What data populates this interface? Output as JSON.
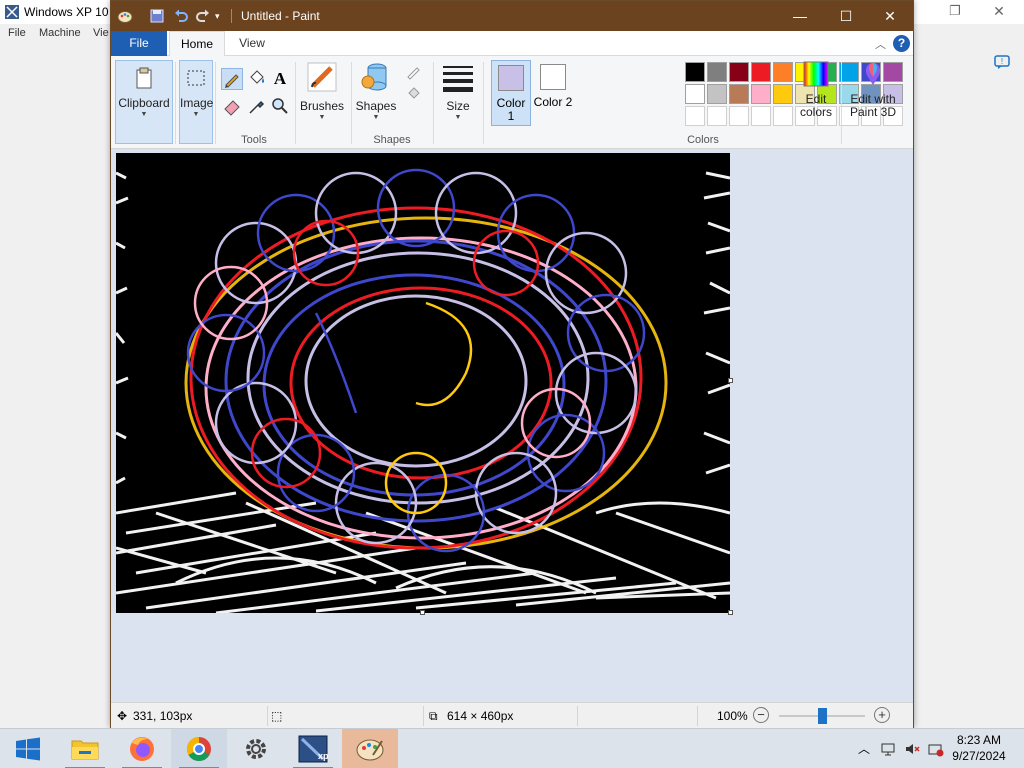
{
  "vm": {
    "title": "Windows XP 10",
    "menu": [
      "File",
      "Machine",
      "Vie"
    ]
  },
  "paint": {
    "title": "Untitled - Paint",
    "tabs": {
      "file": "File",
      "home": "Home",
      "view": "View"
    },
    "ribbon": {
      "clipboard": "Clipboard",
      "image": "Image",
      "tools_group": "Tools",
      "brushes": "Brushes",
      "shapes": "Shapes",
      "shapes_group": "Shapes",
      "size": "Size",
      "color1": "Color 1",
      "color2": "Color 2",
      "colors_group": "Colors",
      "edit_colors": "Edit colors",
      "edit_with_paint3d": "Edit with Paint 3D"
    },
    "colors": {
      "color1": "#c8c0e6",
      "color2": "#ffffff",
      "palette_row1": [
        "#000000",
        "#7f7f7f",
        "#880015",
        "#ed1c24",
        "#ff7f27",
        "#fff200",
        "#22b14c",
        "#00a2e8",
        "#3f48cc",
        "#a349a4"
      ],
      "palette_row2": [
        "#ffffff",
        "#c3c3c3",
        "#b97a57",
        "#ffaec9",
        "#ffc90e",
        "#efe4b0",
        "#b5e61d",
        "#99d9ea",
        "#7092be",
        "#c8bfe7"
      ]
    },
    "status": {
      "cursor_pos": "331, 103px",
      "canvas_size": "614 × 460px",
      "zoom": "100%",
      "zoom_level": 0.5
    }
  },
  "taskbar": {
    "apps": [
      "start-icon",
      "file-explorer-icon",
      "firefox-icon",
      "chrome-icon",
      "settings-icon",
      "vmware-xp-icon",
      "paint-icon"
    ],
    "time": "8:23 AM",
    "date": "9/27/2024"
  }
}
